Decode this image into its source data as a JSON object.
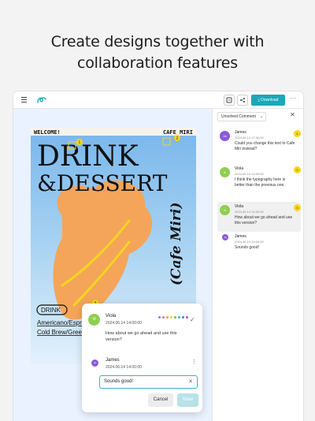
{
  "headline": {
    "line1": "Create designs together with",
    "line2": "collaboration features"
  },
  "toolbar": {
    "download_label": "Download",
    "more_label": "···"
  },
  "poster": {
    "welcome": "WELCOME!",
    "cafe_top": "CAFE MIRI",
    "title_drink": "DRINK",
    "title_dessert": "&DESSERT",
    "vertical": "(Cafe Miri)",
    "badge": "DRINK",
    "menu1": "Americano/Espres",
    "menu2": "Cold Brew/Green"
  },
  "comments": {
    "filter_label": "Unsolved Comment",
    "items": [
      {
        "name": "James",
        "date": "2024.06.13 17:00:00",
        "text": "Could you change this text to Cafe Miri instead?",
        "initials": "Ja",
        "num": "1"
      },
      {
        "name": "Viola",
        "date": "2024.06.14 13:00:00",
        "text": "I think the typography here is better than the previous one.",
        "initials": "Vi",
        "num": "2"
      },
      {
        "name": "Viola",
        "date": "2024.06.14 14:00:00",
        "text": "How about we go ahead and use this version?",
        "initials": "Vi",
        "num": "3"
      },
      {
        "name": "James",
        "date": "2024.06.14 14:00:00",
        "text": "Sounds good!",
        "initials": "Ja"
      }
    ]
  },
  "popup": {
    "name": "Viola",
    "date": "2024.06.14 14:00:00",
    "text": "How about we go ahead and use this version?",
    "initials": "Vi",
    "reply_name": "James",
    "reply_date": "2024.06.14 14:00:00",
    "reply_initials": "Ja",
    "input_value": "Sounds good!",
    "cancel_label": "Cancel",
    "save_label": "Save",
    "color_dots": [
      "#8e7cf0",
      "#f06f9a",
      "#f5a623",
      "#f8d518",
      "#6cc04a",
      "#3fb5d9",
      "#3f7de0",
      "#b24fd1"
    ]
  },
  "colors": {
    "accent": "#1ba7b8",
    "marker": "#f8d518",
    "viola": "#8fce4f",
    "james": "#8a5bd6"
  }
}
